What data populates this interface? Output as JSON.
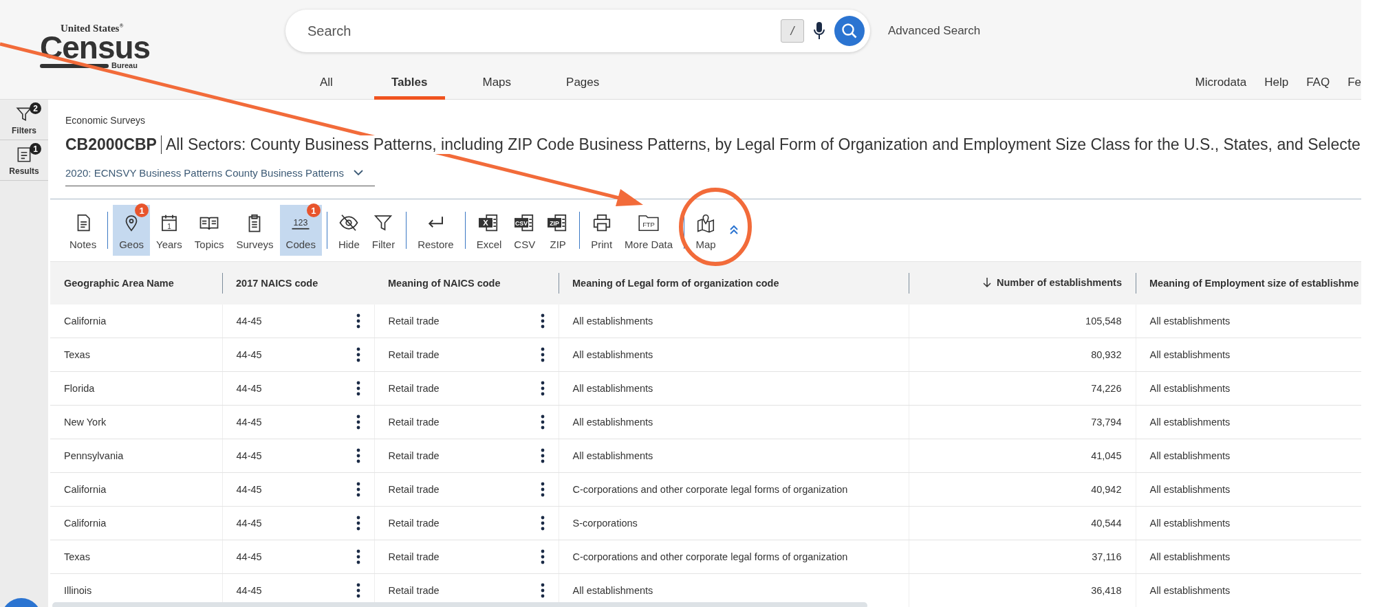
{
  "logo": {
    "top": "United States",
    "mark": "®",
    "main": "Census",
    "bottom": "Bureau"
  },
  "search": {
    "placeholder": "Search",
    "shortcut": "/"
  },
  "advanced_search": "Advanced Search",
  "nav_tabs": [
    {
      "label": "All",
      "selected": false
    },
    {
      "label": "Tables",
      "selected": true
    },
    {
      "label": "Maps",
      "selected": false
    },
    {
      "label": "Pages",
      "selected": false
    }
  ],
  "nav_links": [
    "Microdata",
    "Help",
    "FAQ",
    "Fe"
  ],
  "sidebar": [
    {
      "kind": "filters",
      "label": "Filters",
      "badge": "2"
    },
    {
      "kind": "results",
      "label": "Results",
      "badge": "1"
    }
  ],
  "breadcrumb": "Economic Surveys",
  "title": {
    "code": "CB2000CBP",
    "text": "All Sectors: County Business Patterns, including ZIP Code Business Patterns, by Legal Form of Organization and Employment Size Class for the U.S., States, and Selecte"
  },
  "dataset_dropdown": "2020: ECNSVY Business Patterns County Business Patterns",
  "toolbar": [
    {
      "items": [
        {
          "kind": "notes",
          "label": "Notes",
          "selected": false
        }
      ]
    },
    {
      "items": [
        {
          "kind": "geos",
          "label": "Geos",
          "selected": true,
          "badge": "1"
        },
        {
          "kind": "years",
          "label": "Years",
          "selected": false,
          "icon_text": "1"
        },
        {
          "kind": "topics",
          "label": "Topics",
          "selected": false
        },
        {
          "kind": "surveys",
          "label": "Surveys",
          "selected": false
        },
        {
          "kind": "codes",
          "label": "Codes",
          "selected": true,
          "badge": "1",
          "icon_text": "123"
        }
      ]
    },
    {
      "items": [
        {
          "kind": "hide",
          "label": "Hide",
          "selected": false
        },
        {
          "kind": "filter",
          "label": "Filter",
          "selected": false
        }
      ]
    },
    {
      "items": [
        {
          "kind": "restore",
          "label": "Restore",
          "selected": false
        }
      ]
    },
    {
      "items": [
        {
          "kind": "file",
          "label": "Excel",
          "selected": false,
          "icon_text": "X"
        },
        {
          "kind": "file",
          "label": "CSV",
          "selected": false,
          "icon_text": "CSV"
        },
        {
          "kind": "file",
          "label": "ZIP",
          "selected": false,
          "icon_text": "ZIP"
        }
      ]
    },
    {
      "items": [
        {
          "kind": "print",
          "label": "Print",
          "selected": false
        },
        {
          "kind": "folder",
          "label": "More Data",
          "selected": false,
          "icon_text": "FTP"
        }
      ]
    },
    {
      "items": [
        {
          "kind": "map",
          "label": "Map",
          "selected": false
        },
        {
          "kind": "collapse"
        }
      ]
    }
  ],
  "table": {
    "columns": [
      {
        "label": "Geographic Area Name"
      },
      {
        "label": "2017 NAICS code"
      },
      {
        "label": "Meaning of NAICS code"
      },
      {
        "label": "Meaning of Legal form of organization code"
      },
      {
        "label": "Number of establishments",
        "sorted": true
      },
      {
        "label": "Meaning of Employment size of establishme"
      }
    ],
    "rows": [
      [
        "California",
        "44-45",
        "Retail trade",
        "All establishments",
        "105,548",
        "All establishments"
      ],
      [
        "Texas",
        "44-45",
        "Retail trade",
        "All establishments",
        "80,932",
        "All establishments"
      ],
      [
        "Florida",
        "44-45",
        "Retail trade",
        "All establishments",
        "74,226",
        "All establishments"
      ],
      [
        "New York",
        "44-45",
        "Retail trade",
        "All establishments",
        "73,794",
        "All establishments"
      ],
      [
        "Pennsylvania",
        "44-45",
        "Retail trade",
        "All establishments",
        "41,045",
        "All establishments"
      ],
      [
        "California",
        "44-45",
        "Retail trade",
        "C-corporations and other corporate legal forms of organization",
        "40,942",
        "All establishments"
      ],
      [
        "California",
        "44-45",
        "Retail trade",
        "S-corporations",
        "40,544",
        "All establishments"
      ],
      [
        "Texas",
        "44-45",
        "Retail trade",
        "C-corporations and other corporate legal forms of organization",
        "37,116",
        "All establishments"
      ],
      [
        "Illinois",
        "44-45",
        "Retail trade",
        "All establishments",
        "36,418",
        "All establishments"
      ]
    ]
  }
}
